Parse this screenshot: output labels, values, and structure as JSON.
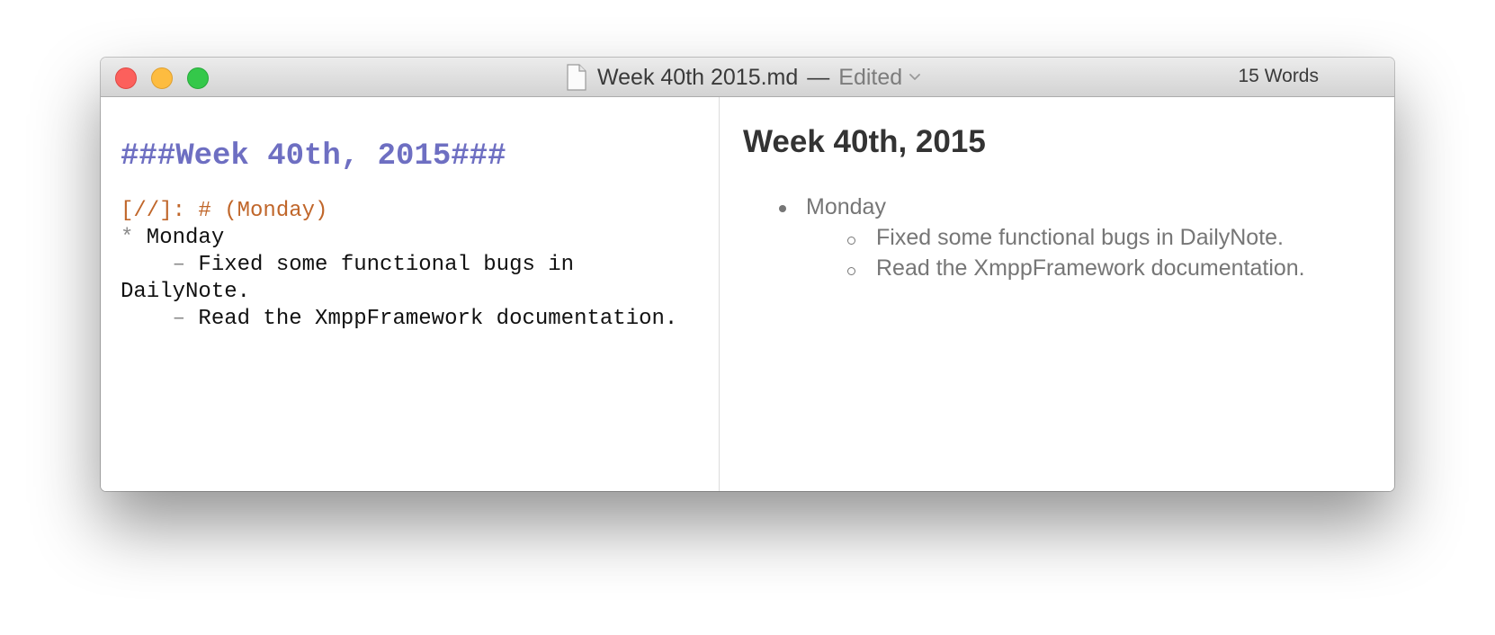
{
  "window": {
    "filename": "Week 40th 2015.md",
    "separator": "—",
    "status": "Edited",
    "word_count": "15 Words"
  },
  "icons": {
    "close": "close-icon",
    "minimize": "minimize-icon",
    "zoom": "zoom-icon",
    "document": "document-icon",
    "chevron": "chevron-down-icon"
  },
  "colors": {
    "heading_markdown": "#6e6fc2",
    "comment_markdown": "#c0662a",
    "close": "#fc605c",
    "minimize": "#fdbc40",
    "zoom": "#34c84a"
  },
  "editor": {
    "heading": "###Week 40th, 2015###",
    "comment": "[//]: # (Monday)",
    "bullet_marker": "*",
    "bullet_text": " Monday",
    "dash_1": "    –",
    "line_1_text": " Fixed some functional bugs in",
    "line_1_cont": "DailyNote.",
    "dash_2": "    –",
    "line_2_text": " Read the XmppFramework documentation."
  },
  "preview": {
    "heading": "Week 40th, 2015",
    "item": "Monday",
    "subitems": [
      "Fixed some functional bugs in DailyNote.",
      "Read the XmppFramework documentation."
    ]
  }
}
